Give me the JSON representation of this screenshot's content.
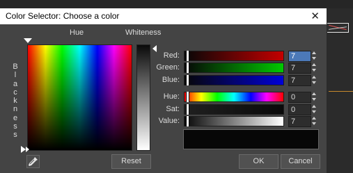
{
  "window": {
    "title": "Color Selector: Choose a color",
    "close_glyph": "✕"
  },
  "picker": {
    "hue_label": "Hue",
    "whiteness_label": "Whiteness",
    "blackness_label": "Blackness"
  },
  "rows": [
    {
      "label": "Red:",
      "value": "7",
      "selected": true
    },
    {
      "label": "Green:",
      "value": "7"
    },
    {
      "label": "Blue:",
      "value": "7"
    },
    {
      "label": "Hue:",
      "value": "0"
    },
    {
      "label": "Sat:",
      "value": "0"
    },
    {
      "label": "Value:",
      "value": "7"
    }
  ],
  "buttons": {
    "reset": "Reset",
    "ok": "OK",
    "cancel": "Cancel"
  },
  "colors": {
    "dialog_bg": "#444444",
    "current_color": "#070707",
    "red_gradient_end": "#c40000",
    "green_gradient_end": "#00c800",
    "blue_gradient_end": "#0000d8",
    "selected_field": "#4c79b8"
  },
  "icons": {
    "eyedropper": "eyedropper-icon"
  }
}
